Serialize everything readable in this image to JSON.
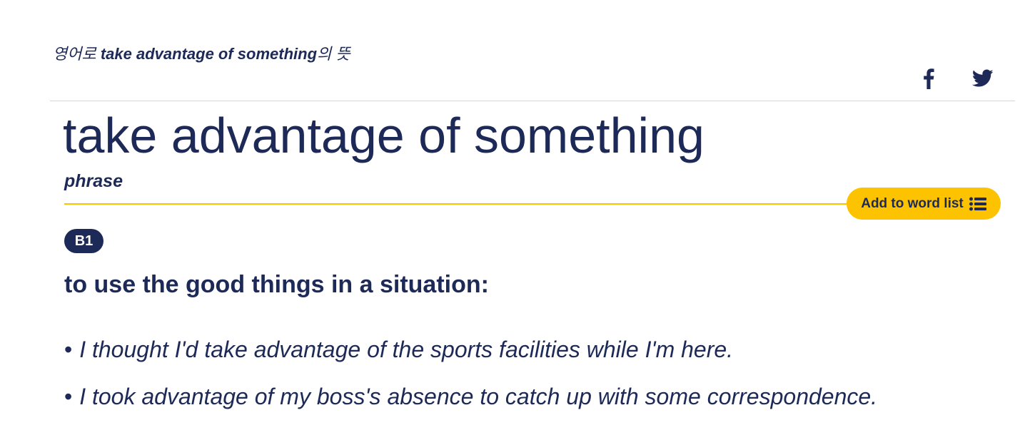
{
  "header": {
    "subtitle_prefix": "영어로 ",
    "subtitle_term": "take advantage of something",
    "subtitle_suffix": "의 뜻",
    "share": [
      {
        "icon": "facebook-icon"
      },
      {
        "icon": "twitter-icon"
      }
    ]
  },
  "entry": {
    "headword": "take advantage of something",
    "part_of_speech": "phrase",
    "add_to_word_list_label": "Add to word list",
    "level": "B1",
    "definition": "to use the good things in a situation:",
    "examples": [
      "I thought I'd take advantage of the sports facilities while I'm here.",
      "I took advantage of my boss's absence to catch up with some correspondence."
    ]
  },
  "colors": {
    "text": "#1d2a57",
    "accent_yellow": "#fdc300",
    "rule": "#d8d8d8"
  }
}
